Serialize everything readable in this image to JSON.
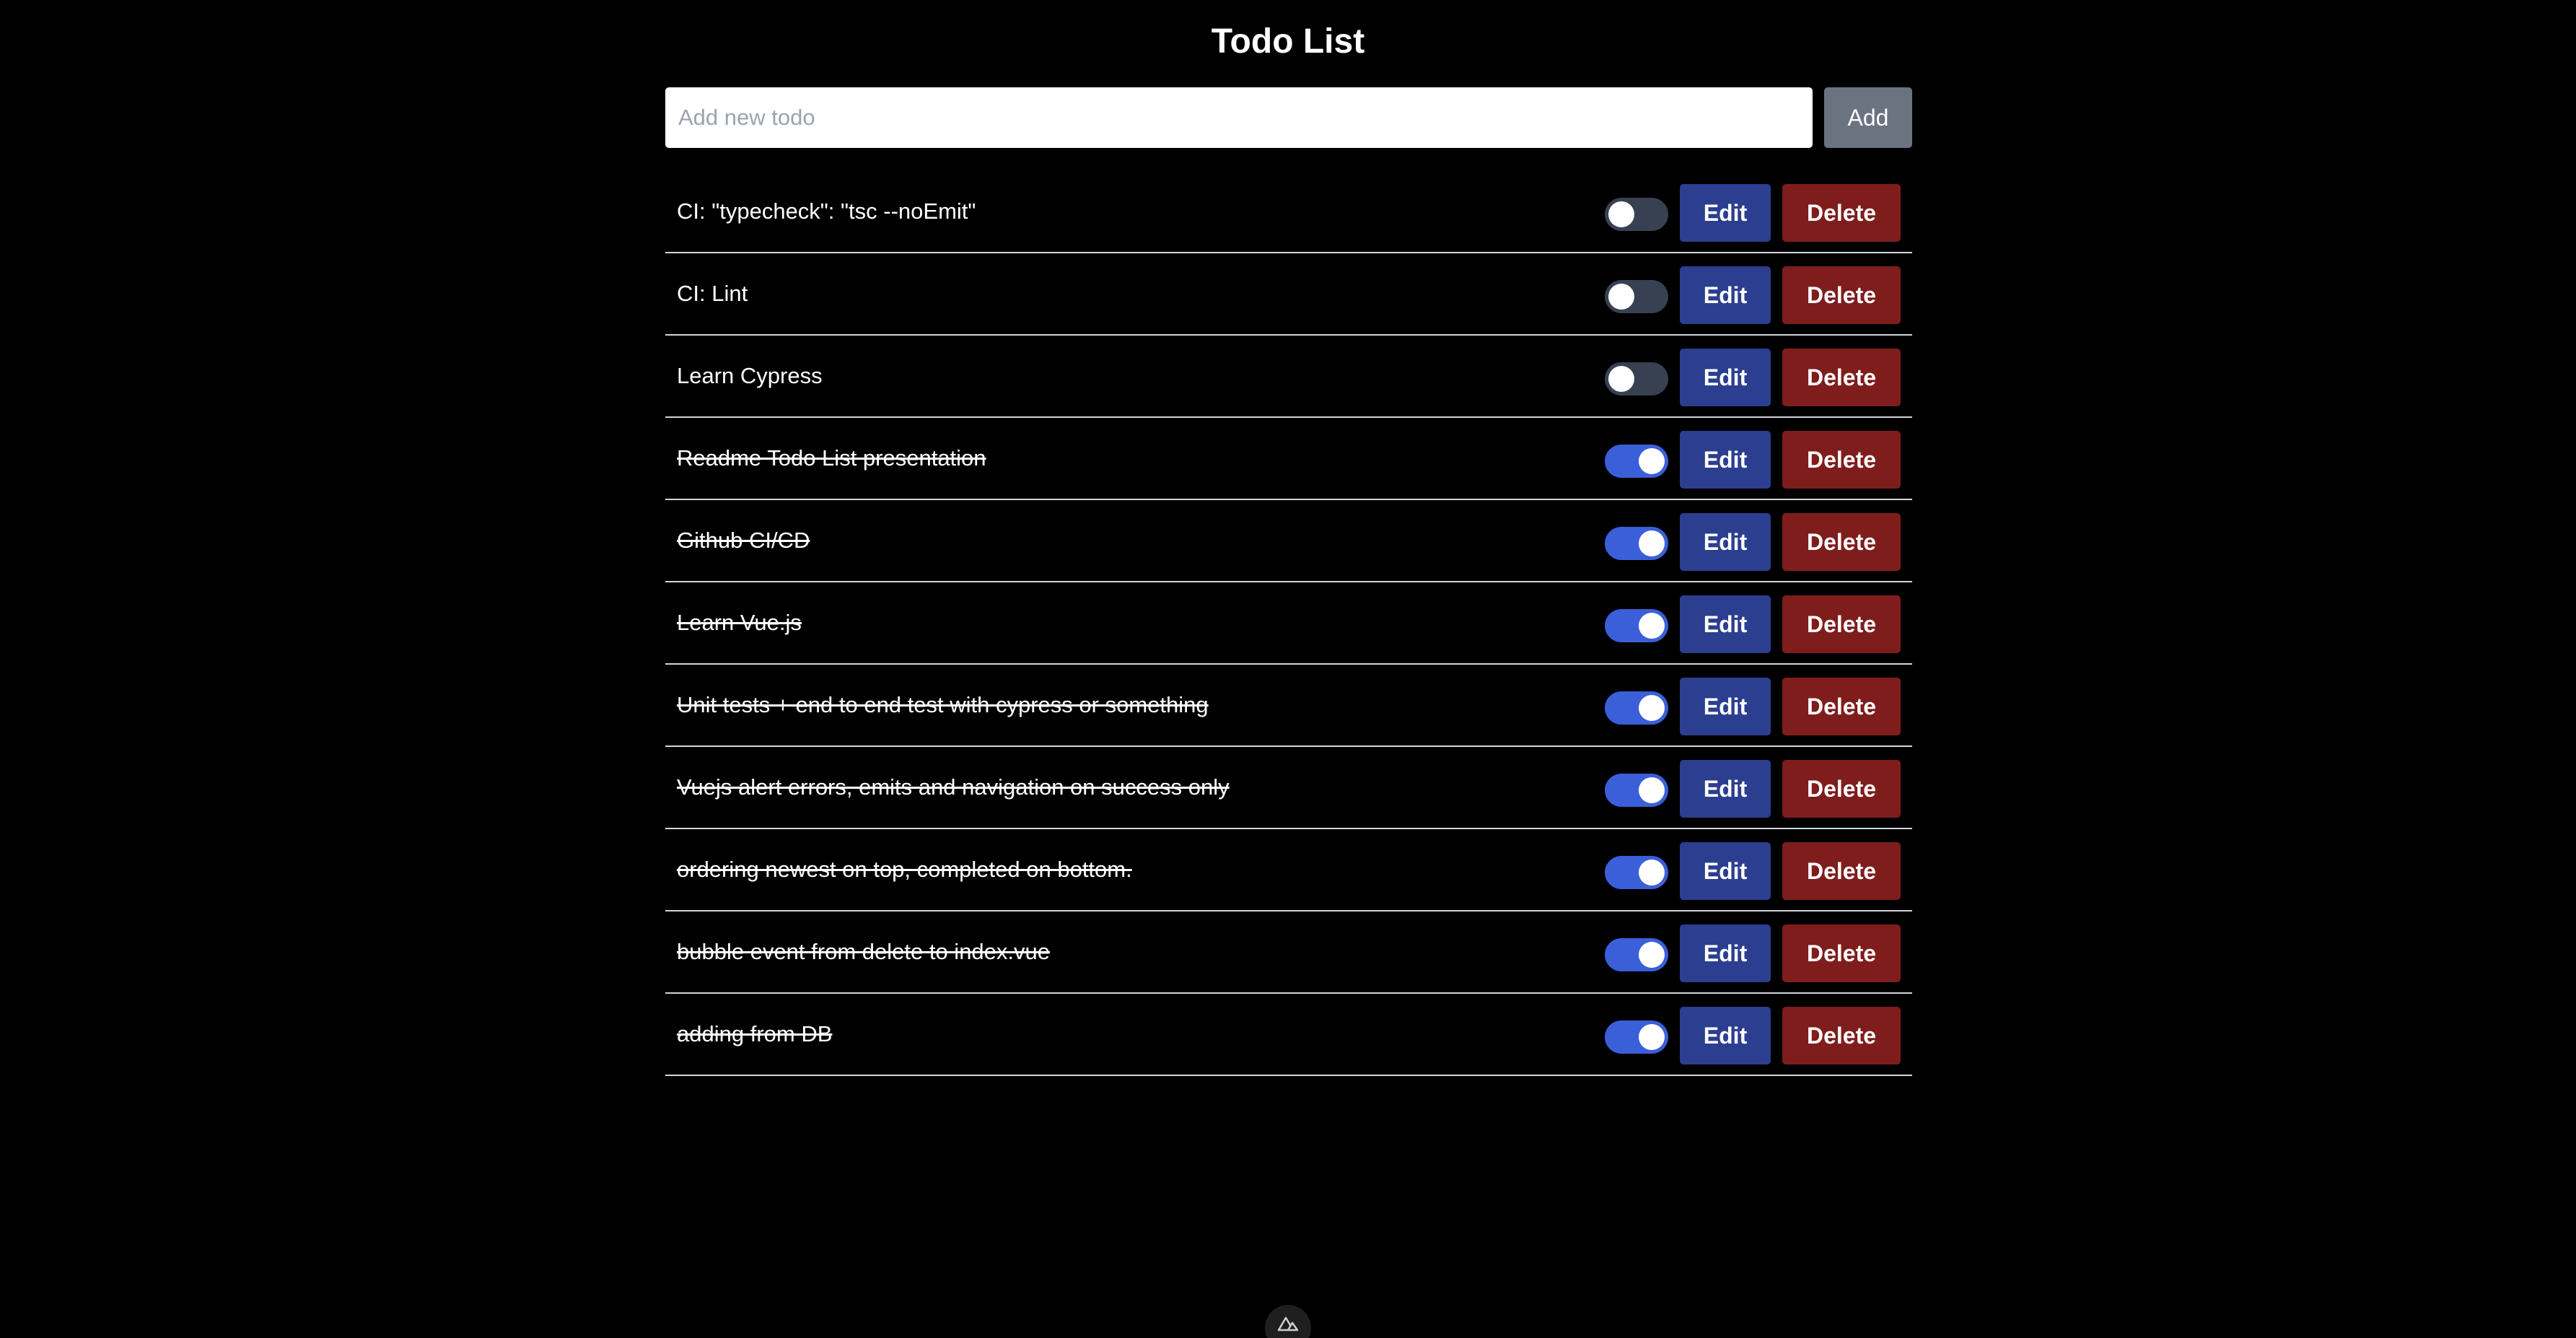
{
  "page": {
    "title": "Todo List"
  },
  "new_todo": {
    "placeholder": "Add new todo",
    "value": "",
    "add_label": "Add"
  },
  "todos": [
    {
      "text": "CI: \"typecheck\": \"tsc --noEmit\"",
      "completed": false,
      "edit_label": "Edit",
      "delete_label": "Delete"
    },
    {
      "text": "CI: Lint",
      "completed": false,
      "edit_label": "Edit",
      "delete_label": "Delete"
    },
    {
      "text": "Learn Cypress",
      "completed": false,
      "edit_label": "Edit",
      "delete_label": "Delete"
    },
    {
      "text": "Readme Todo List presentation",
      "completed": true,
      "edit_label": "Edit",
      "delete_label": "Delete"
    },
    {
      "text": "Github CI/CD",
      "completed": true,
      "edit_label": "Edit",
      "delete_label": "Delete"
    },
    {
      "text": "Learn Vue.js",
      "completed": true,
      "edit_label": "Edit",
      "delete_label": "Delete"
    },
    {
      "text": "Unit tests + end to end test with cypress or something",
      "completed": true,
      "edit_label": "Edit",
      "delete_label": "Delete"
    },
    {
      "text": "Vuejs alert errors, emits and navigation on success only",
      "completed": true,
      "edit_label": "Edit",
      "delete_label": "Delete"
    },
    {
      "text": "ordering newest on top, completed on bottom.",
      "completed": true,
      "edit_label": "Edit",
      "delete_label": "Delete"
    },
    {
      "text": "bubble event from delete to index.vue",
      "completed": true,
      "edit_label": "Edit",
      "delete_label": "Delete"
    },
    {
      "text": "adding from DB",
      "completed": true,
      "edit_label": "Edit",
      "delete_label": "Delete"
    }
  ],
  "footer": {
    "devtools_icon": "nuxt-logo-icon"
  },
  "colors": {
    "background": "#000000",
    "add_button": "#6b7280",
    "edit_button": "#2c3e8f",
    "delete_button": "#7f1d1d",
    "toggle_on": "#3b5fd9",
    "toggle_off": "#374151"
  }
}
